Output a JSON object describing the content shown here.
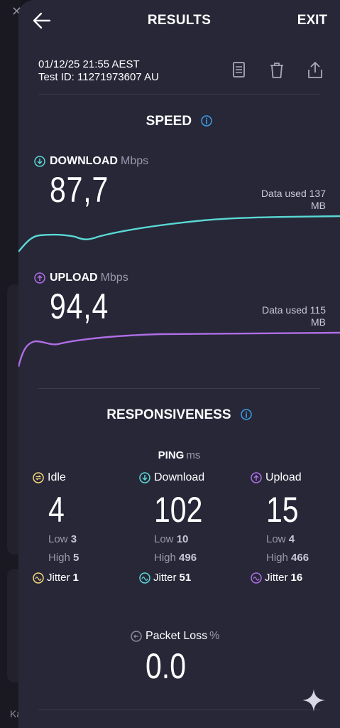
{
  "header": {
    "title": "RESULTS",
    "exit_label": "EXIT"
  },
  "test": {
    "datetime": "01/12/25 21:55 AEST",
    "test_id": "Test ID: 11271973607 AU"
  },
  "speed": {
    "title": "SPEED",
    "download": {
      "label": "DOWNLOAD",
      "unit": "Mbps",
      "value": "87,7",
      "data_used": "Data used 137",
      "data_used_unit": "MB",
      "color": "#5ad8d4"
    },
    "upload": {
      "label": "UPLOAD",
      "unit": "Mbps",
      "value": "94,4",
      "data_used": "Data used 115",
      "data_used_unit": "MB",
      "color": "#b06ee6"
    }
  },
  "responsiveness": {
    "title": "RESPONSIVENESS",
    "ping_label": "PING",
    "ping_unit": "ms",
    "columns": [
      {
        "label": "Idle",
        "value": "4",
        "low_label": "Low",
        "low": "3",
        "high_label": "High",
        "high": "5",
        "jitter_label": "Jitter",
        "jitter": "1",
        "color": "#f4d77a"
      },
      {
        "label": "Download",
        "value": "102",
        "low_label": "Low",
        "low": "10",
        "high_label": "High",
        "high": "496",
        "jitter_label": "Jitter",
        "jitter": "51",
        "color": "#5ad8d4"
      },
      {
        "label": "Upload",
        "value": "15",
        "low_label": "Low",
        "low": "4",
        "high_label": "High",
        "high": "466",
        "jitter_label": "Jitter",
        "jitter": "16",
        "color": "#b06ee6"
      }
    ],
    "packet_loss": {
      "label": "Packet Loss",
      "unit": "%",
      "value": "0.0"
    }
  },
  "background": {
    "partial_text": "Ka"
  },
  "icons": [
    "back-arrow-icon",
    "report-icon",
    "trash-icon",
    "share-icon",
    "info-icon",
    "download-arrow-icon",
    "upload-arrow-icon",
    "idle-icon",
    "jitter-icon",
    "packet-loss-icon",
    "sparkle-icon"
  ]
}
